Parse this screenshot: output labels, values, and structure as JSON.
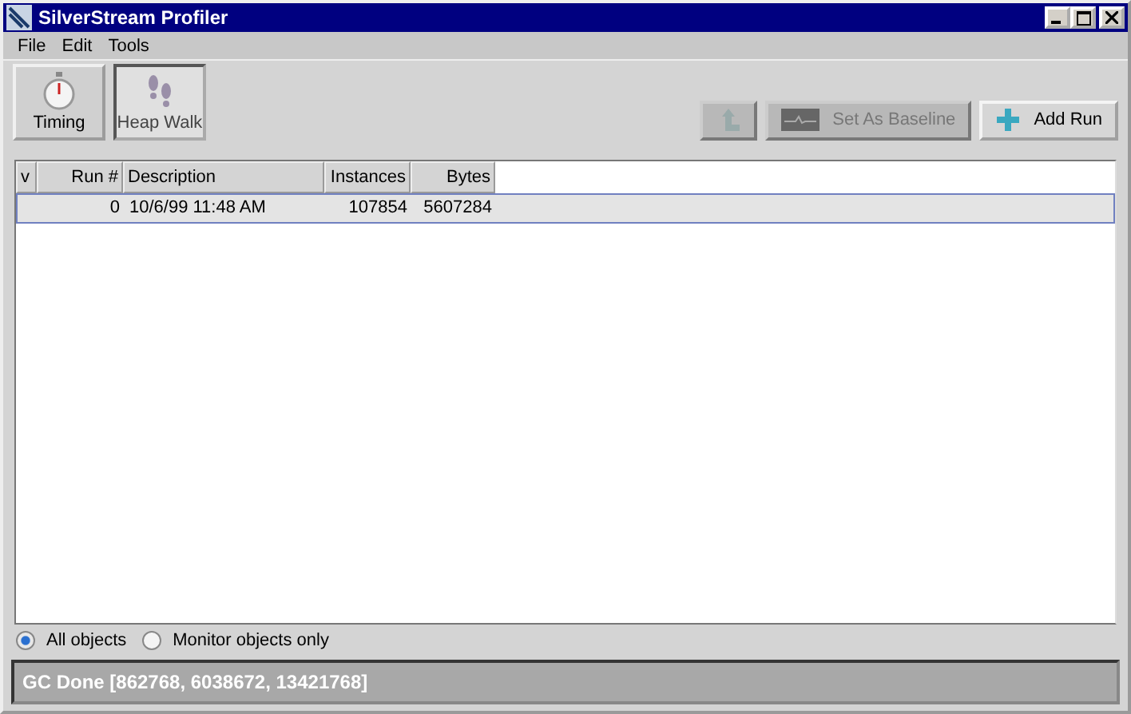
{
  "window": {
    "title": "SilverStream Profiler"
  },
  "menu": [
    "File",
    "Edit",
    "Tools"
  ],
  "views": [
    {
      "label": "Timing",
      "kind": "timer",
      "selected": false
    },
    {
      "label": "Heap Walk",
      "kind": "steps",
      "selected": true
    }
  ],
  "actions": [
    {
      "kind": "up",
      "disabled": true
    },
    {
      "kind": "baseline",
      "label": "Set As Baseline",
      "disabled": true
    },
    {
      "kind": "add",
      "label": "Add Run",
      "disabled": false
    }
  ],
  "table": {
    "columns": [
      "v",
      "Run #",
      "Description",
      "Instances",
      "Bytes"
    ],
    "rows": [
      {
        "cells": [
          "",
          "0",
          "10/6/99 11:48 AM",
          "107854",
          "5607284"
        ],
        "selected": true
      }
    ]
  },
  "filters": [
    {
      "label": "All objects",
      "selected": true
    },
    {
      "label": "Monitor objects only",
      "selected": false
    }
  ],
  "status_bar": "GC Done [862768, 6038672, 13421768]"
}
